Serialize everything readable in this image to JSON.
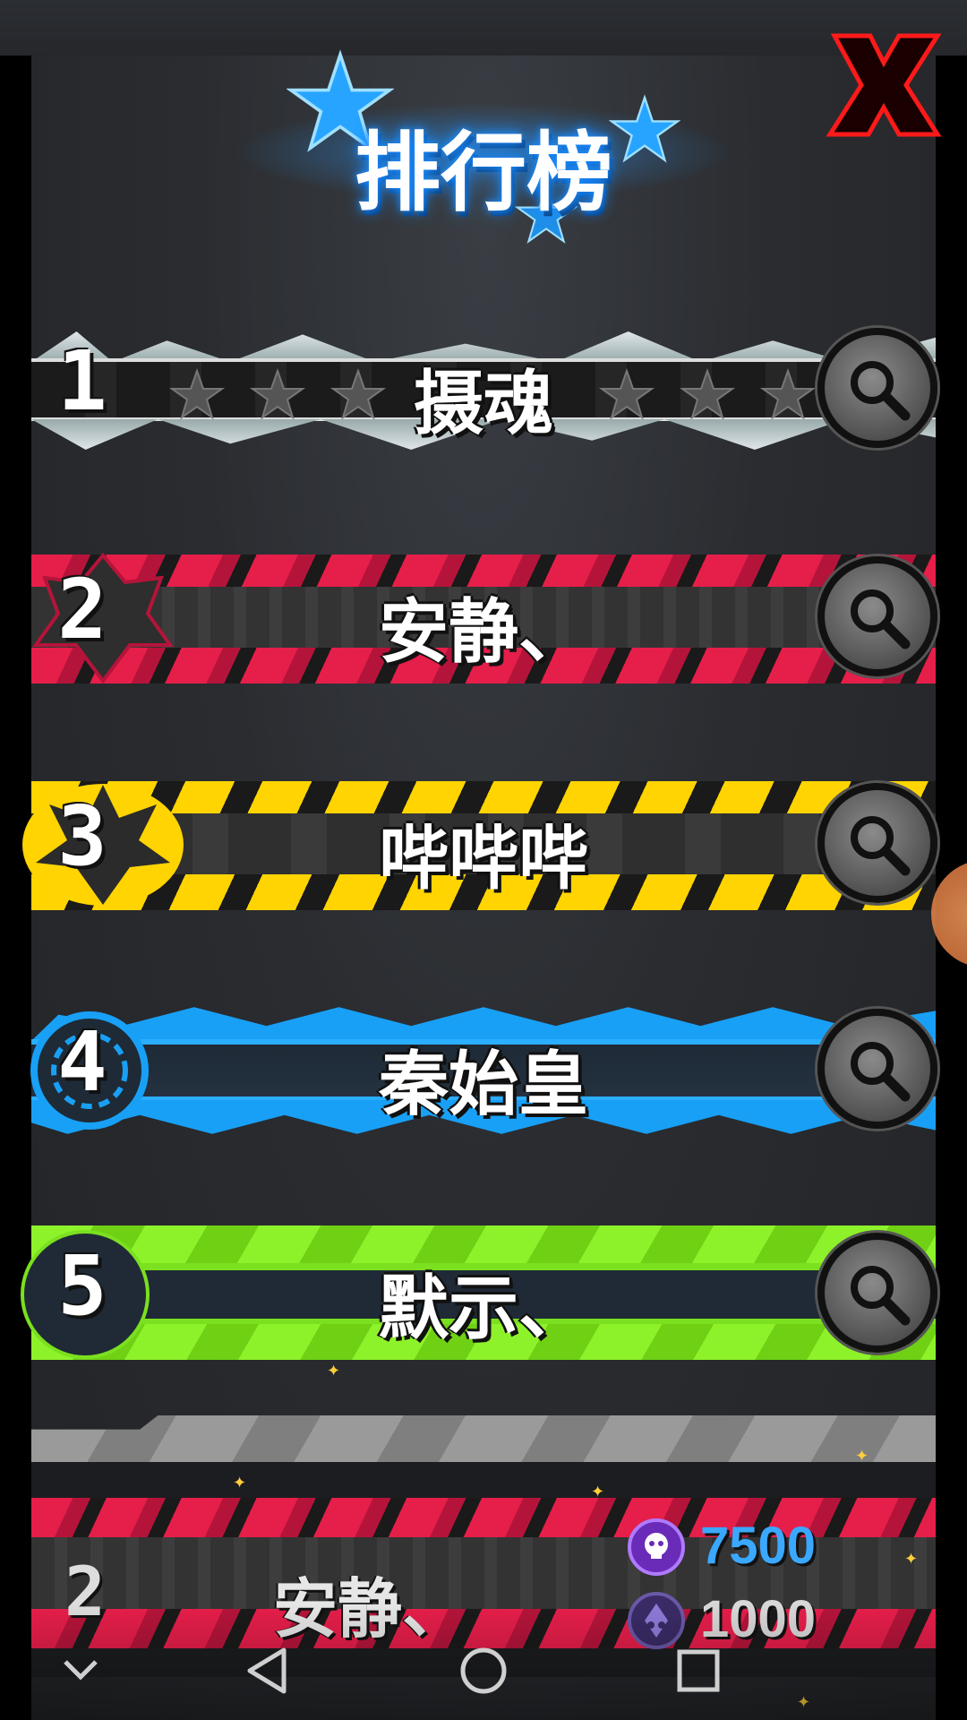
{
  "title": "排行榜",
  "close_label": "X",
  "leaderboard": [
    {
      "rank": "1",
      "name": "摄魂",
      "theme": "silver"
    },
    {
      "rank": "2",
      "name": "安静、",
      "theme": "red"
    },
    {
      "rank": "3",
      "name": "哔哔哔",
      "theme": "yellow"
    },
    {
      "rank": "4",
      "name": "秦始皇",
      "theme": "blue"
    },
    {
      "rank": "5",
      "name": "默示、",
      "theme": "green"
    }
  ],
  "self_entry": {
    "rank": "2",
    "name": "安静、",
    "currencies": [
      {
        "icon": "purple-skull-coin-icon",
        "amount": "7500",
        "color": "#3aa8ff"
      },
      {
        "icon": "purple-gem-coin-icon",
        "amount": "1000",
        "color": "#d8d8d8"
      }
    ]
  },
  "colors": {
    "title_glow": "#1a8cff",
    "close": "#e01010",
    "red_theme": "#e61e4a",
    "yellow_theme": "#ffd400",
    "blue_theme": "#18a0f6",
    "green_theme": "#7be01f"
  },
  "navbar": {
    "icons": [
      "chevron-down-icon",
      "back-triangle-icon",
      "home-circle-icon",
      "recents-square-icon"
    ]
  }
}
